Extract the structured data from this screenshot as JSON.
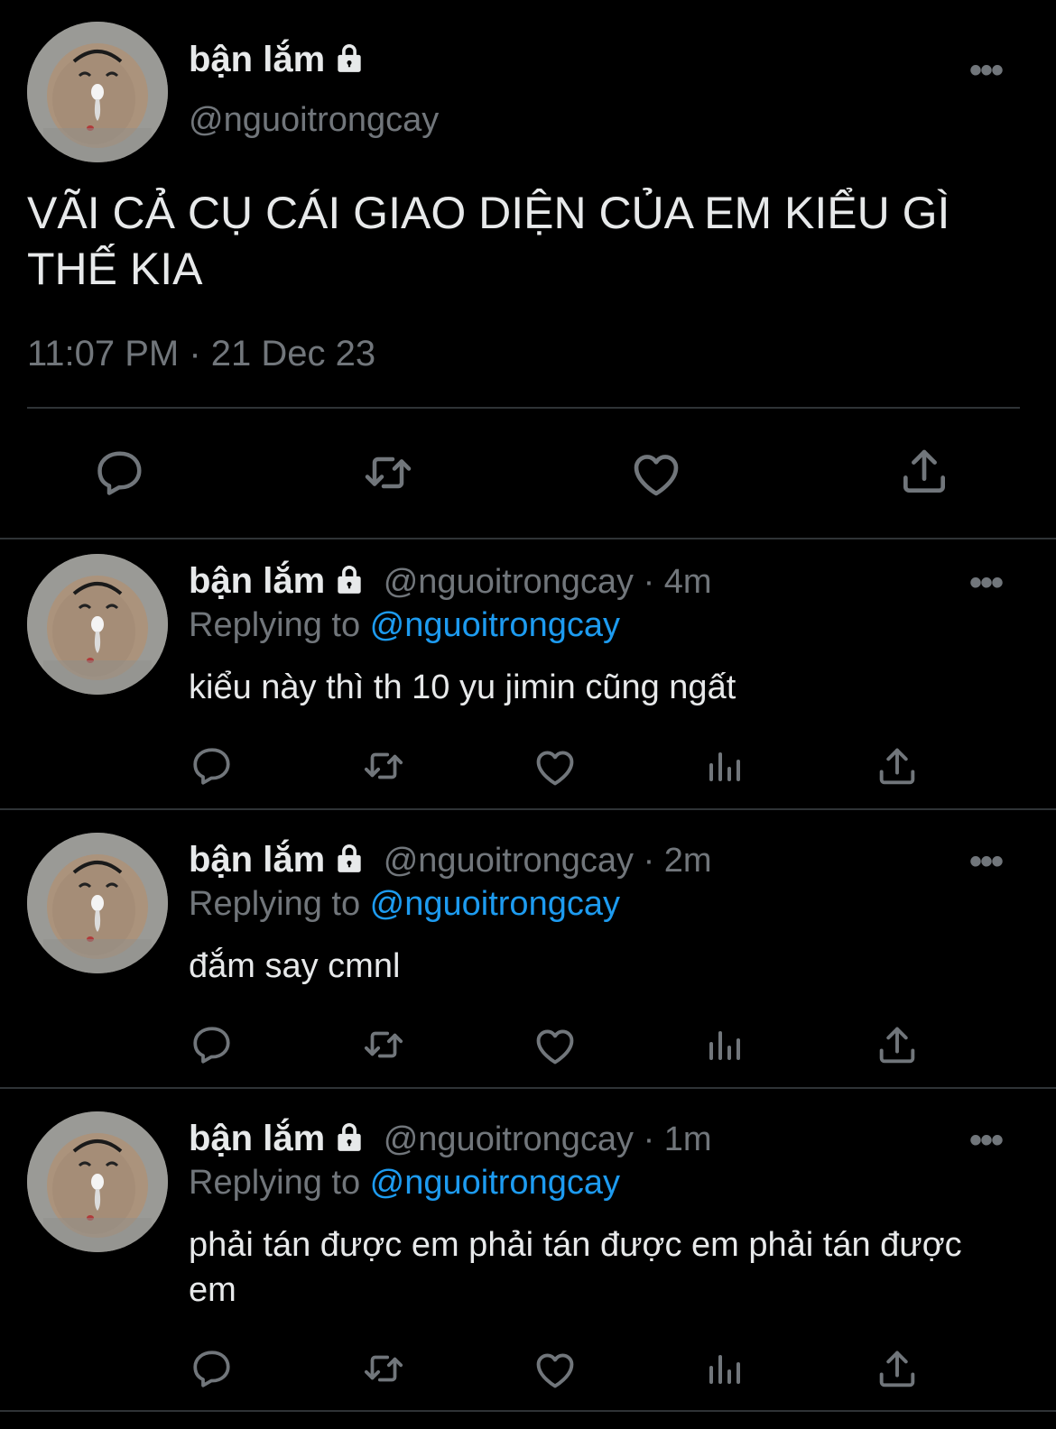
{
  "main_tweet": {
    "display_name": "bận lắm",
    "handle": "@nguoitrongcay",
    "text": "VÃI CẢ CỤ CÁI GIAO DIỆN CỦA EM KIỂU GÌ THẾ KIA",
    "timestamp": "11:07 PM · 21 Dec 23",
    "actions": [
      "reply-icon",
      "retweet-icon",
      "like-icon",
      "share-icon"
    ]
  },
  "replies": [
    {
      "display_name": "bận lắm",
      "meta": "@nguoitrongcay · 4m",
      "replying_prefix": "Replying to ",
      "replying_to": "@nguoitrongcay",
      "text": "kiểu này thì th 10 yu jimin cũng ngất"
    },
    {
      "display_name": "bận lắm",
      "meta": "@nguoitrongcay · 2m",
      "replying_prefix": "Replying to ",
      "replying_to": "@nguoitrongcay",
      "text": "đắm say cmnl"
    },
    {
      "display_name": "bận lắm",
      "meta": "@nguoitrongcay · 1m",
      "replying_prefix": "Replying to ",
      "replying_to": "@nguoitrongcay",
      "text": "phải tán được em phải tán được em phải tán được em"
    }
  ],
  "more_label": "•••",
  "colors": {
    "background": "#000000",
    "text": "#e7e9ea",
    "secondary": "#71767b",
    "link": "#1d9bf0",
    "divider": "#2f3336"
  }
}
